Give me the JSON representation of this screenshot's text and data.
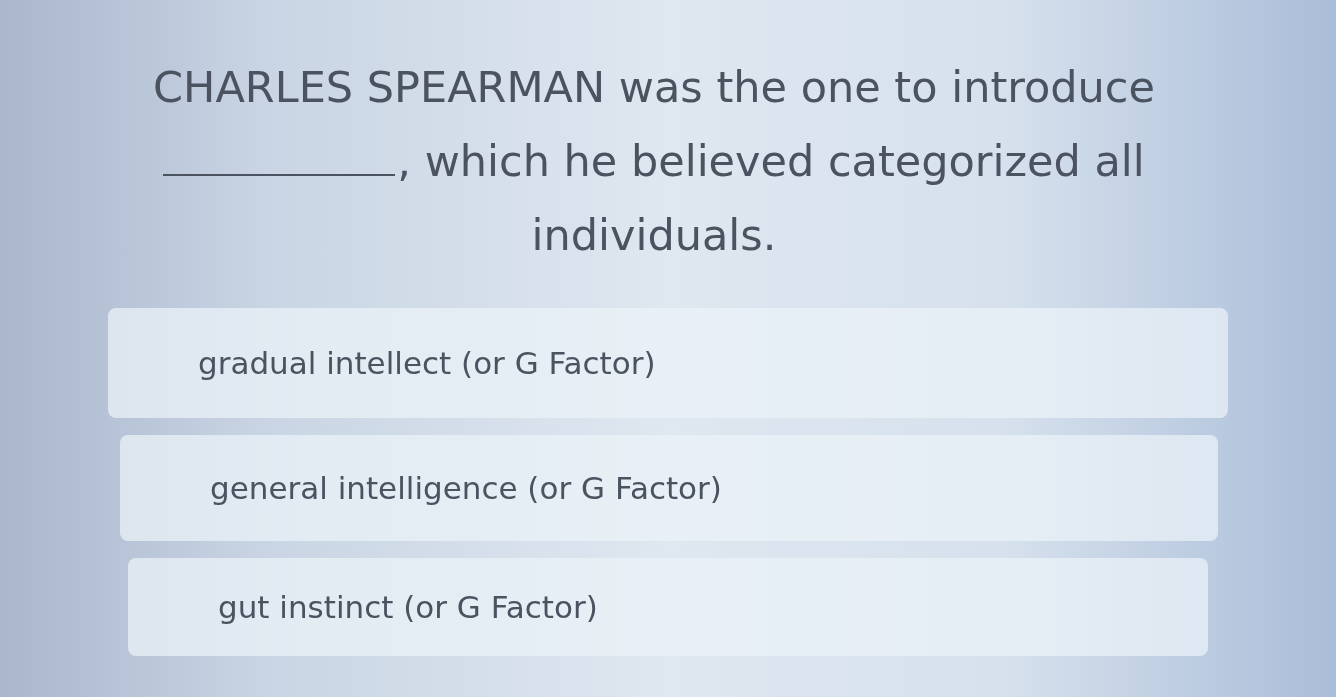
{
  "question": {
    "before_blank": "CHARLES SPEARMAN was the one to introduce",
    "after_blank": ", which he believed categorized all individuals."
  },
  "options": [
    {
      "label": "gradual intellect (or G Factor)",
      "selected": false
    },
    {
      "label": "general intelligence (or G Factor)",
      "selected": false
    },
    {
      "label": "gut instinct (or G Factor)",
      "selected": false
    }
  ]
}
